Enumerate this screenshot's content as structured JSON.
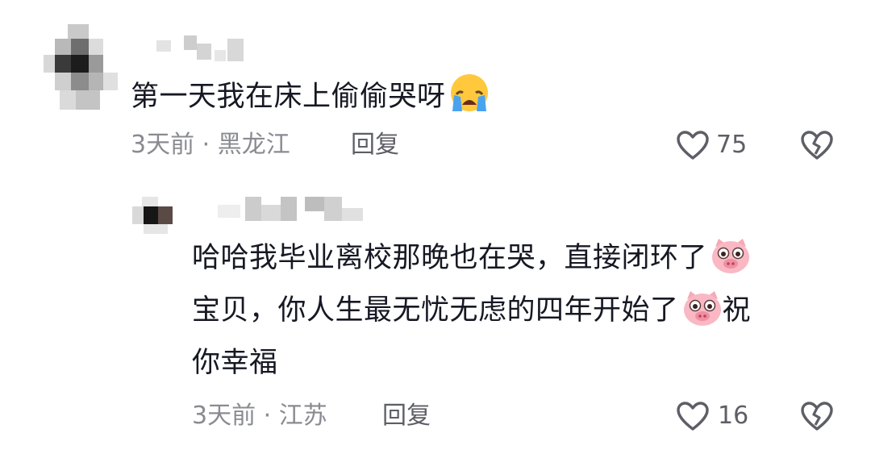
{
  "comments": [
    {
      "text": "第一天我在床上偷偷哭呀",
      "emoji": "loudly-crying-face",
      "time": "3天前",
      "separator": "·",
      "location": "黑龙江",
      "reply_label": "回复",
      "likes": "75"
    },
    {
      "text_line1": "哈哈我毕业离校那晚也在哭，直接闭环了",
      "text_line2": "宝贝，你人生最无忧无虑的四年开始了",
      "text_line2_tail": "祝",
      "text_line3": "你幸福",
      "emoji": "pig-face",
      "time": "3天前",
      "separator": "·",
      "location": "江苏",
      "reply_label": "回复",
      "likes": "16"
    }
  ],
  "colors": {
    "text": "#161823",
    "meta": "#8a8b91",
    "icon": "#5d5e66"
  }
}
